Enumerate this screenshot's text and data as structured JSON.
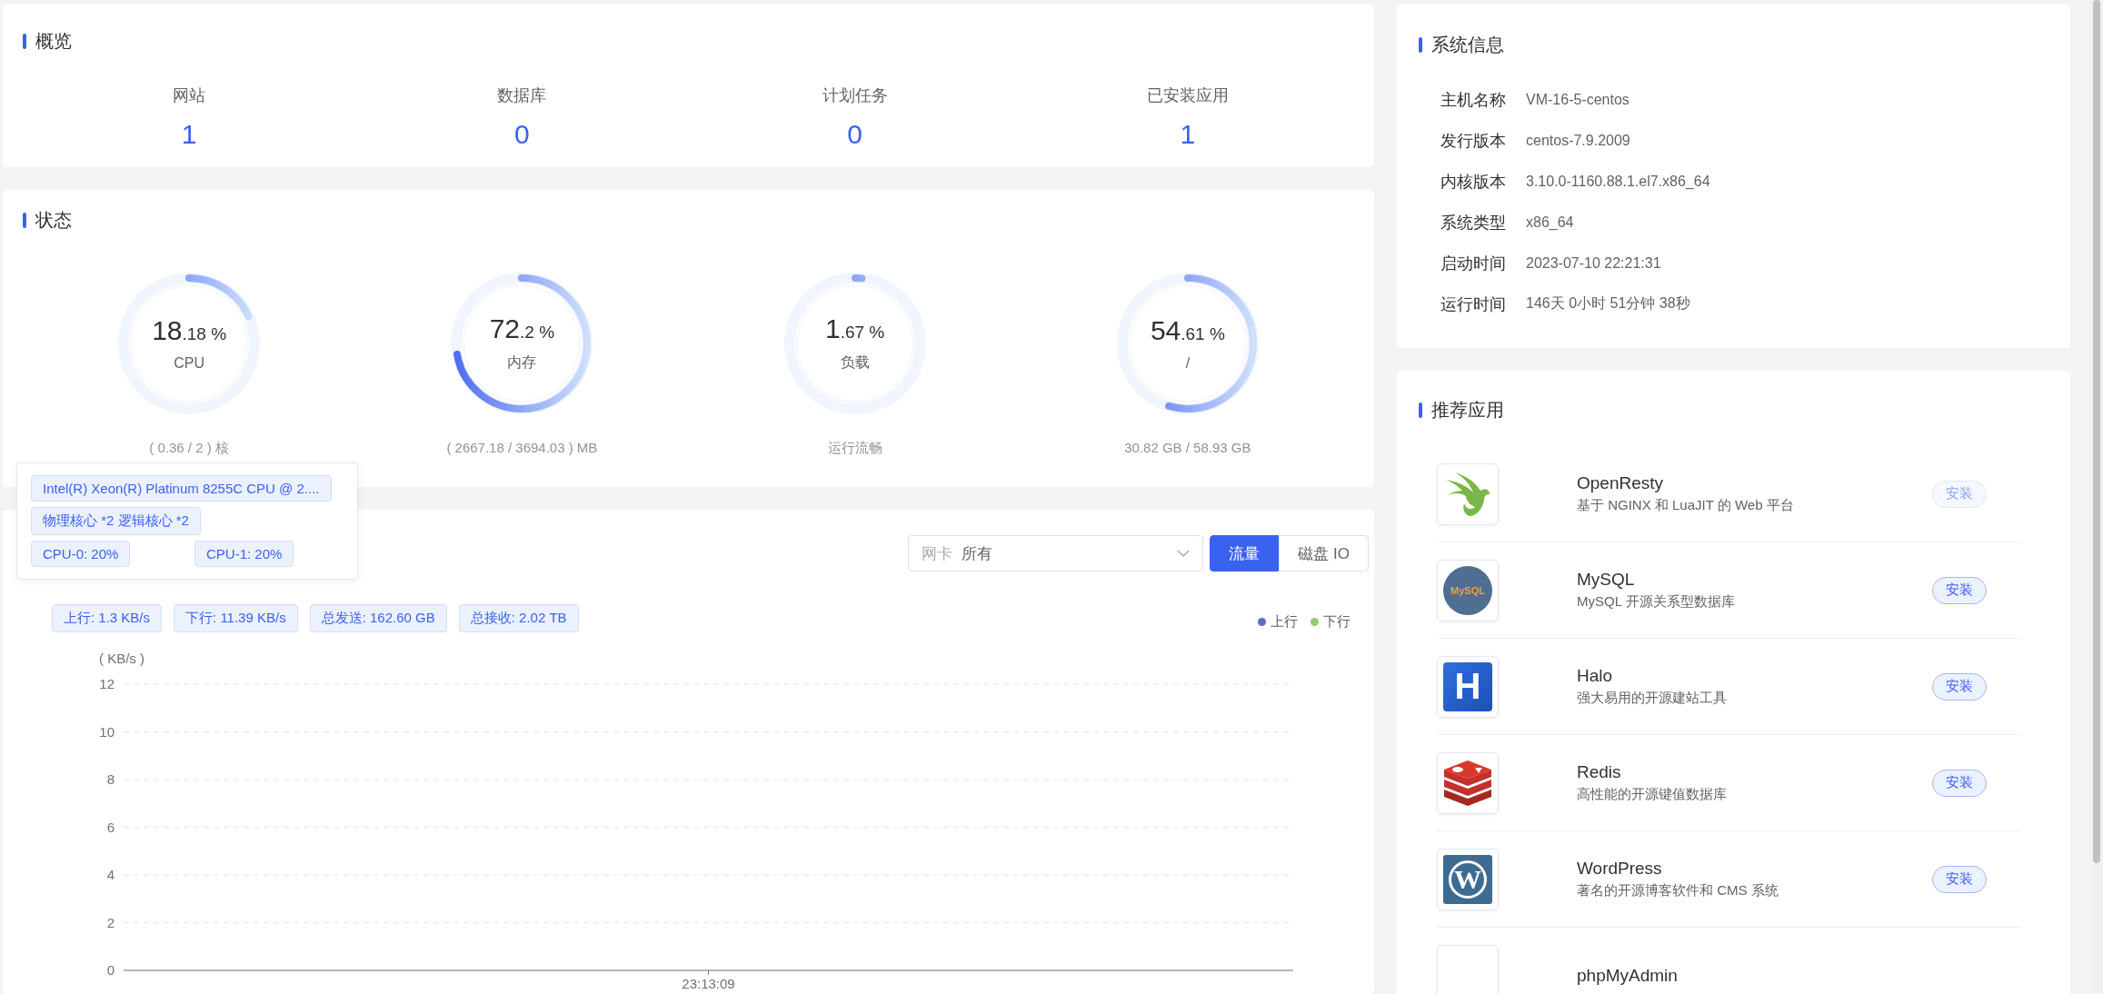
{
  "overview": {
    "title": "概览",
    "items": [
      {
        "label": "网站",
        "value": "1"
      },
      {
        "label": "数据库",
        "value": "0"
      },
      {
        "label": "计划任务",
        "value": "0"
      },
      {
        "label": "已安装应用",
        "value": "1"
      }
    ]
  },
  "status": {
    "title": "状态",
    "gauges": [
      {
        "integer": "18",
        "fraction": ".18 %",
        "label": "CPU",
        "level": 0.1818,
        "detail": "( 0.36 / 2 ) 核"
      },
      {
        "integer": "72",
        "fraction": ".2 %",
        "label": "内存",
        "level": 0.722,
        "detail": "( 2667.18 / 3694.03 ) MB"
      },
      {
        "integer": "1",
        "fraction": ".67 %",
        "label": "负载",
        "level": 0.0167,
        "detail": "运行流畅"
      },
      {
        "integer": "54",
        "fraction": ".61 %",
        "label": "/",
        "level": 0.5461,
        "detail": "30.82 GB / 58.93 GB"
      }
    ],
    "tooltip": {
      "model": "Intel(R) Xeon(R) Platinum 8255C CPU @ 2....",
      "cores": "物理核心 *2 逻辑核心 *2",
      "cpus": [
        "CPU-0: 20%",
        "CPU-1: 20%"
      ]
    }
  },
  "network": {
    "select": {
      "label": "网卡",
      "value": "所有"
    },
    "tabs": [
      {
        "label": "流量",
        "selected": true
      },
      {
        "label": "磁盘 IO",
        "selected": false
      }
    ],
    "stats": [
      "上行: 1.3 KB/s",
      "下行: 11.39 KB/s",
      "总发送: 162.60 GB",
      "总接收: 2.02 TB"
    ],
    "chart_data": {
      "type": "line",
      "grid": true,
      "ylabel": "( KB/s )",
      "x": [
        "23:13:09"
      ],
      "ylim": [
        0,
        12
      ],
      "yticks": [
        0,
        2,
        4,
        6,
        8,
        10,
        12
      ],
      "series": [
        {
          "name": "上行",
          "color": "#5470c6",
          "values": [
            null
          ]
        },
        {
          "name": "下行",
          "color": "#91cc75",
          "values": [
            null
          ]
        }
      ]
    }
  },
  "system_info": {
    "title": "系统信息",
    "rows": [
      {
        "label": "主机名称",
        "value": "VM-16-5-centos"
      },
      {
        "label": "发行版本",
        "value": "centos-7.9.2009"
      },
      {
        "label": "内核版本",
        "value": "3.10.0-1160.88.1.el7.x86_64"
      },
      {
        "label": "系统类型",
        "value": "x86_64"
      },
      {
        "label": "启动时间",
        "value": "2023-07-10 22:21:31"
      },
      {
        "label": "运行时间",
        "value": "146天 0小时 51分钟 38秒"
      }
    ]
  },
  "apps": {
    "title": "推荐应用",
    "items": [
      {
        "kind": "bird",
        "name": "OpenResty",
        "description": "基于 NGINX 和 LuaJIT 的 Web 平台",
        "button": "安装",
        "disabled": true
      },
      {
        "kind": "dolphin",
        "logo_text": "MySQL",
        "name": "MySQL",
        "description": "MySQL 开源关系型数据库",
        "button": "安装",
        "disabled": false
      },
      {
        "kind": "letter",
        "logo_text": "H",
        "name": "Halo",
        "description": "强大易用的开源建站工具",
        "button": "安装",
        "disabled": false
      },
      {
        "kind": "stack",
        "name": "Redis",
        "description": "高性能的开源键值数据库",
        "button": "安装",
        "disabled": false
      },
      {
        "kind": "wordpress",
        "logo_text": "W",
        "name": "WordPress",
        "description": "著名的开源博客软件和 CMS 系统",
        "button": "安装",
        "disabled": false
      },
      {
        "kind": "blank",
        "name": "phpMyAdmin"
      }
    ]
  }
}
